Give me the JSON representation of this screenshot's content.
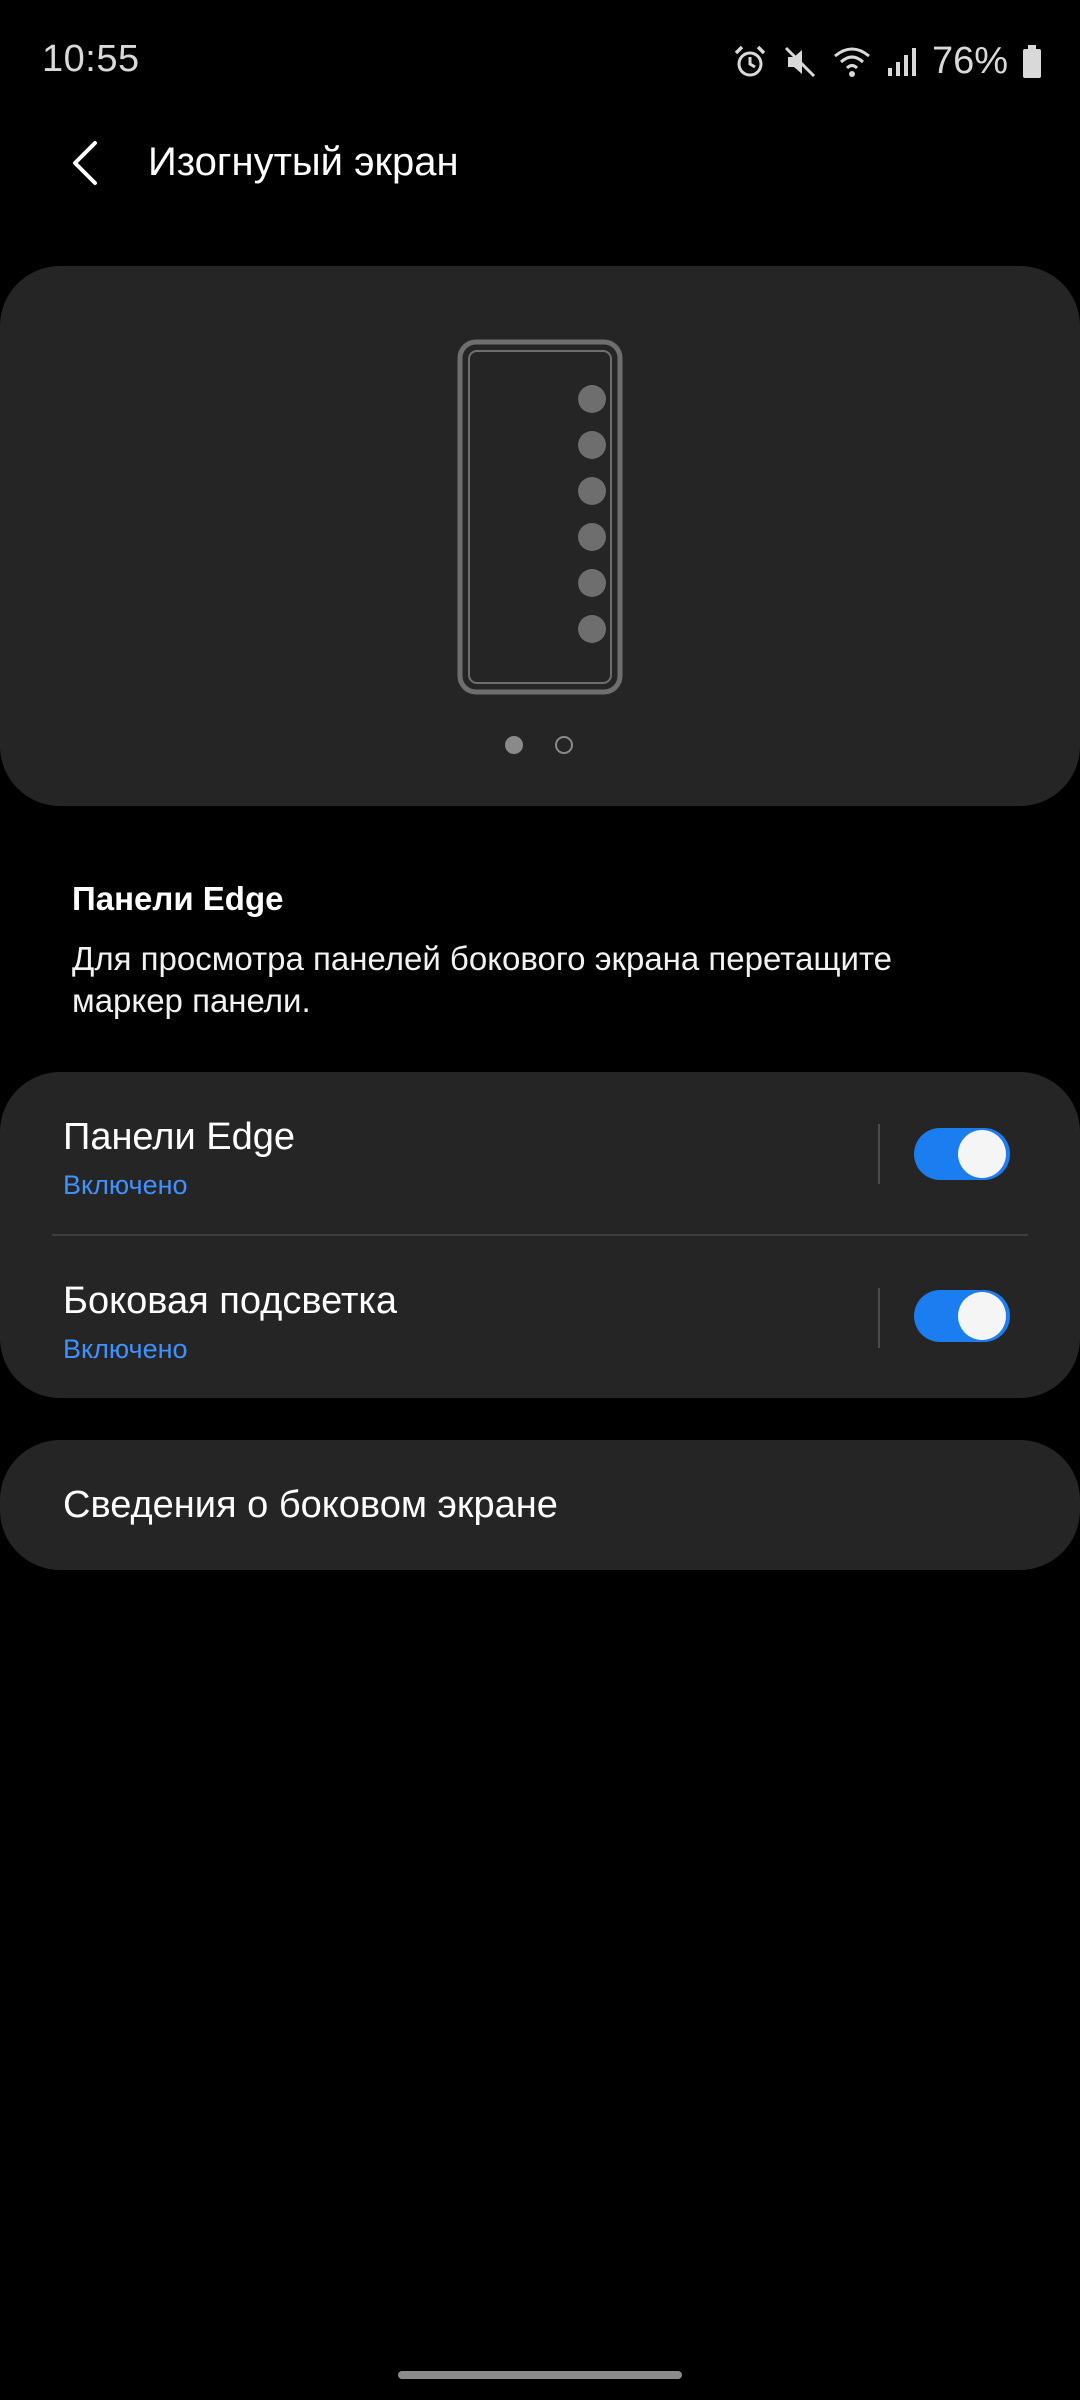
{
  "status_bar": {
    "time": "10:55",
    "battery_percent": "76%",
    "icons": [
      "alarm-icon",
      "mute-icon",
      "wifi-icon",
      "signal-icon",
      "battery-icon"
    ]
  },
  "header": {
    "title": "Изогнутый экран",
    "back_icon": "chevron-left-icon"
  },
  "illustration": {
    "pages": 2,
    "active_page": 1
  },
  "description": {
    "title": "Панели Edge",
    "text": "Для просмотра панелей бокового экрана перетащите маркер панели."
  },
  "settings": [
    {
      "label": "Панели Edge",
      "status": "Включено",
      "enabled": true
    },
    {
      "label": "Боковая подсветка",
      "status": "Включено",
      "enabled": true
    }
  ],
  "info_item": {
    "label": "Сведения о боковом экране"
  },
  "colors": {
    "background": "#000000",
    "card": "#252525",
    "accent": "#1a7ef0",
    "status_text": "#3e91ff"
  }
}
